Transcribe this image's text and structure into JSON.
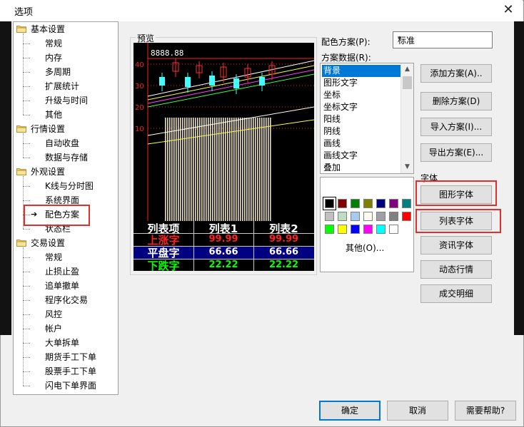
{
  "window": {
    "title": "选项",
    "close_glyph": "✕"
  },
  "tree": {
    "groups": [
      {
        "label": "基本设置",
        "items": [
          "常规",
          "内存",
          "多周期",
          "扩展统计",
          "升级与时间",
          "其他"
        ]
      },
      {
        "label": "行情设置",
        "items": [
          "自动收盘",
          "数据与存储"
        ]
      },
      {
        "label": "外观设置",
        "items": [
          "K线与分时图",
          "系统界面",
          "配色方案",
          "状态栏"
        ]
      },
      {
        "label": "交易设置",
        "items": [
          "常规",
          "止损止盈",
          "追单撤单",
          "程序化交易",
          "风控",
          "帐户",
          "大单拆单",
          "期货手工下单",
          "股票手工下单",
          "闪电下单界面"
        ]
      }
    ],
    "selected": "配色方案"
  },
  "preview": {
    "label": "预览",
    "price_readout": "8888.88",
    "y_ticks": [
      "40",
      "30",
      "20",
      "10"
    ],
    "table": {
      "headers": [
        "列表项",
        "列表1",
        "列表2"
      ],
      "rows": [
        {
          "name": "上涨字",
          "v1": "99.99",
          "v2": "99.99",
          "color": "#ff2020"
        },
        {
          "name": "平盘字",
          "v1": "66.66",
          "v2": "66.66",
          "color": "#ffffff",
          "bg": "#000080"
        },
        {
          "name": "下跌字",
          "v1": "22.22",
          "v2": "22.22",
          "color": "#00ff00"
        }
      ]
    }
  },
  "scheme": {
    "label": "配色方案(P):",
    "selected": "标准",
    "data_label": "方案数据(R):",
    "items": [
      "背景",
      "图形文字",
      "坐标",
      "坐标文字",
      "阳线",
      "阴线",
      "画线",
      "画线文字",
      "叠加"
    ],
    "selected_item": "背景"
  },
  "palette": {
    "colors": [
      "#000000",
      "#800000",
      "#008000",
      "#808000",
      "#000080",
      "#800080",
      "#008080",
      "#c0c0c0",
      "#c0dcc0",
      "#a6caf0",
      "#fffbf0",
      "#a0a0a4",
      "#808080",
      "#ff0000",
      "#00ff00",
      "#ffff00",
      "#0000ff",
      "#ff00ff",
      "#00ffff",
      "#ffffff"
    ],
    "other_label": "其他(O)..."
  },
  "buttons": {
    "add": "添加方案(A)..",
    "delete": "删除方案(D)",
    "import": "导入方案(I)...",
    "export": "导出方案(E)...",
    "font_group": "字体",
    "chart_font": "图形字体",
    "list_font": "列表字体",
    "info_font": "资讯字体",
    "dynamic_quote": "动态行情",
    "trade_detail": "成交明细",
    "ok": "确定",
    "cancel": "取消",
    "help": "需要帮助?"
  }
}
